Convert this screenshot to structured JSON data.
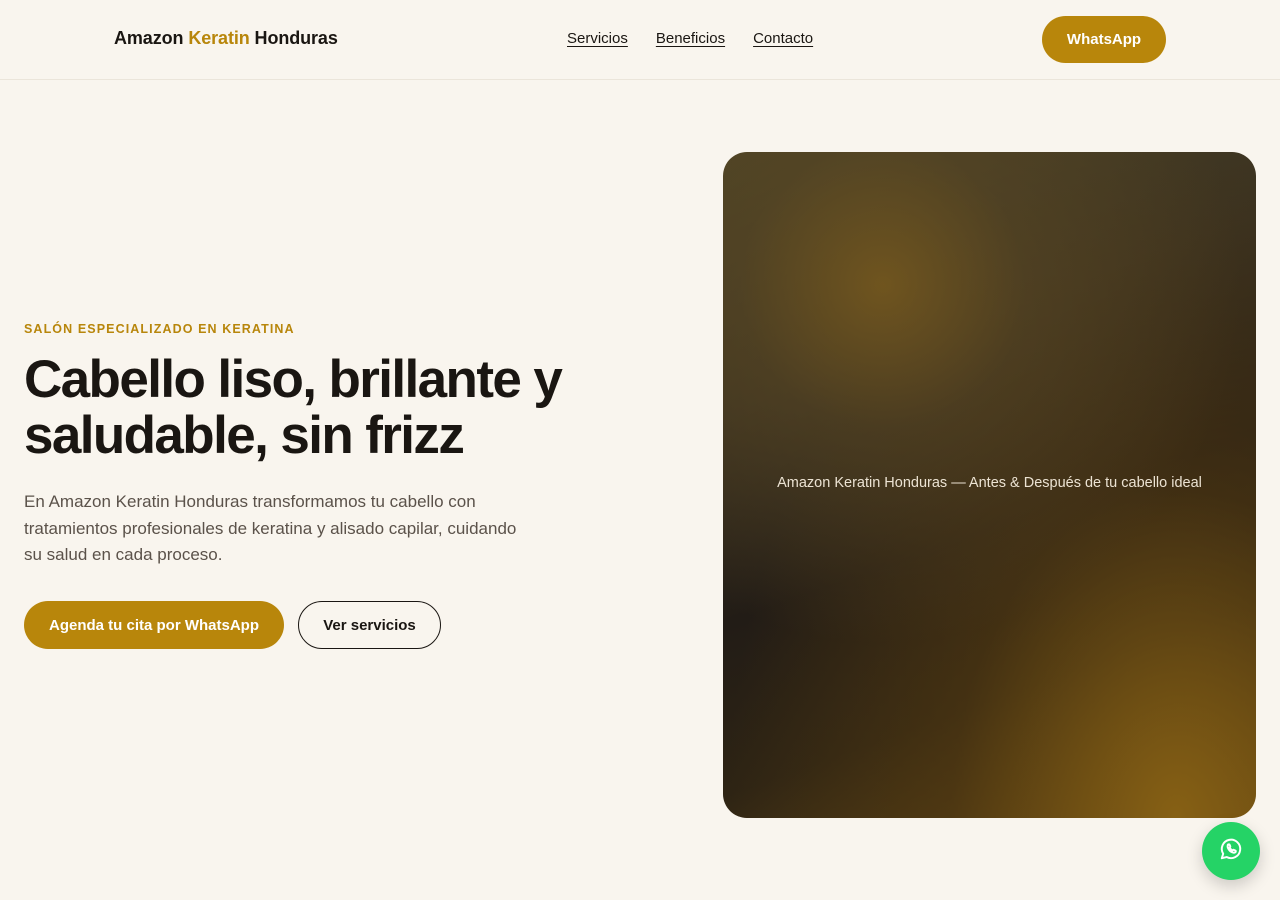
{
  "header": {
    "brand_part1": "Amazon",
    "brand_accent": "Keratin",
    "brand_part2": "Honduras",
    "nav": [
      "Servicios",
      "Beneficios",
      "Contacto"
    ],
    "cta_label": "WhatsApp"
  },
  "hero": {
    "eyebrow": "SALÓN ESPECIALIZADO EN KERATINA",
    "headline": "Cabello liso, brillante y saludable, sin frizz",
    "lead": "En Amazon Keratin Honduras transformamos tu cabello con tratamientos profesionales de keratina y alisado capilar, cuidando su salud en cada proceso.",
    "primary_cta": "Agenda tu cita por WhatsApp",
    "secondary_cta": "Ver servicios",
    "image_caption": "Amazon Keratin Honduras — Antes & Después de tu cabello ideal"
  },
  "floating": {
    "icon": "whatsapp-icon"
  },
  "colors": {
    "background": "#f9f5ee",
    "accent": "#b8860b",
    "text": "#1a1612",
    "whatsapp_green": "#25d366"
  }
}
